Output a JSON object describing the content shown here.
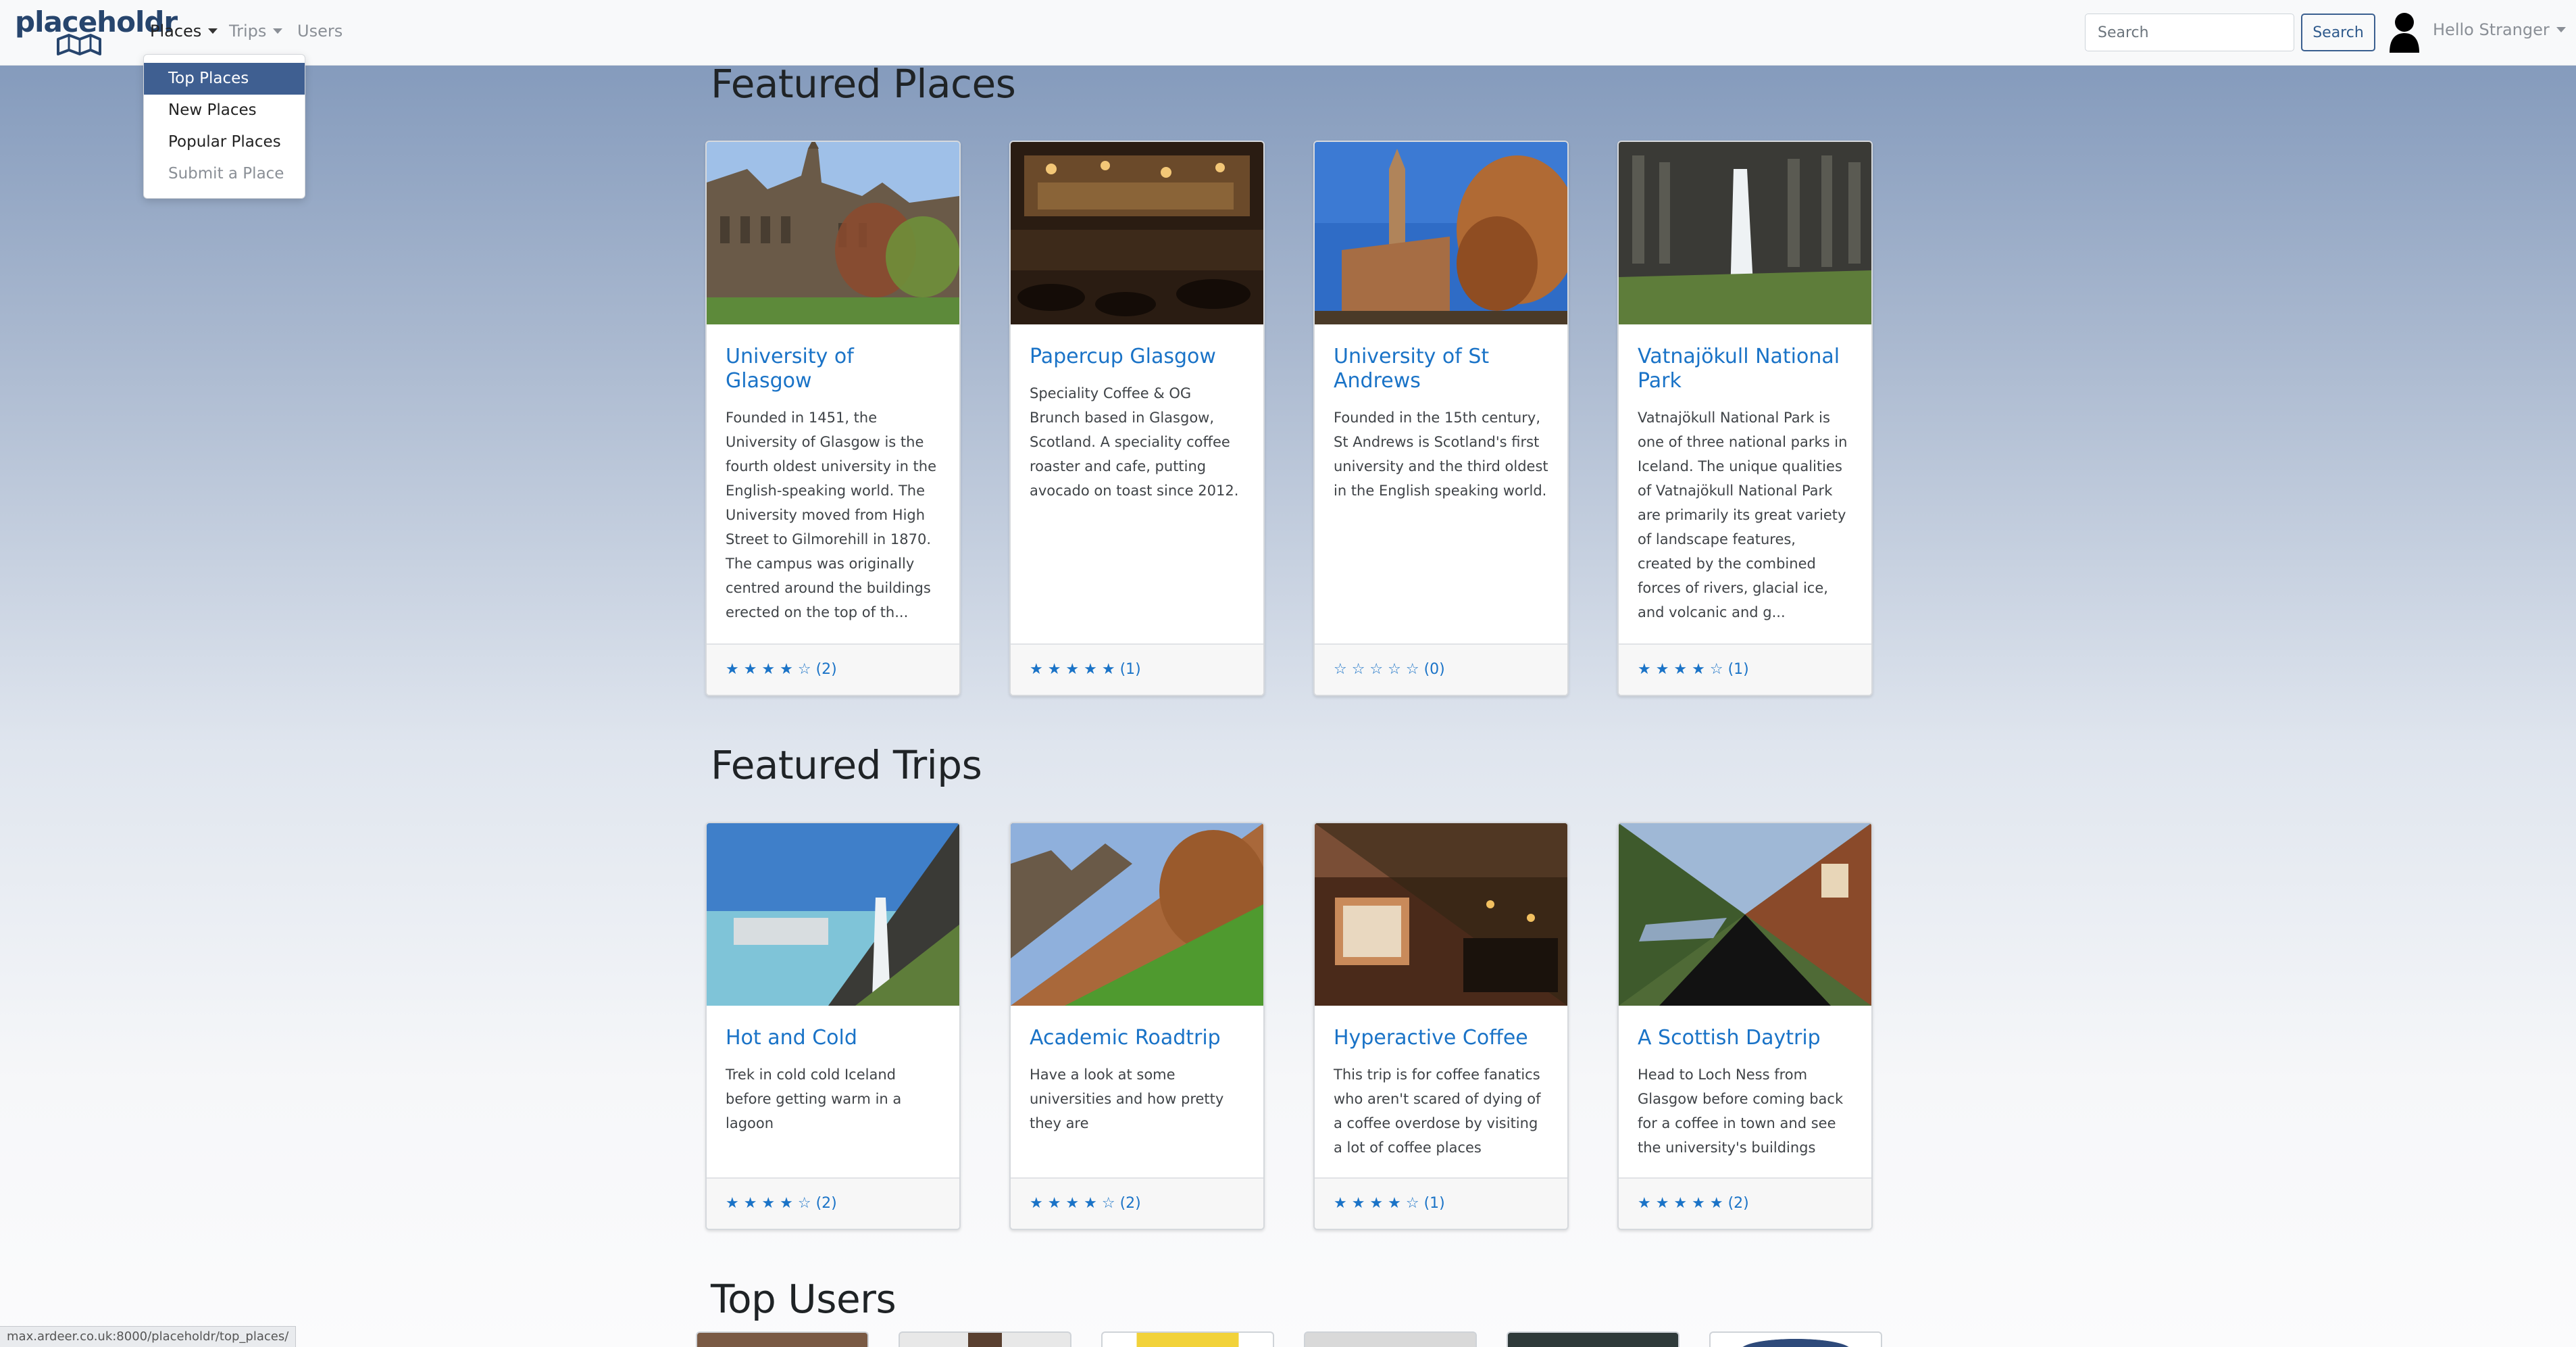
{
  "navbar": {
    "brand": "placeholdr",
    "menu": [
      {
        "label": "Places",
        "has_dropdown": true,
        "state": "open"
      },
      {
        "label": "Trips",
        "has_dropdown": true,
        "state": "muted"
      },
      {
        "label": "Users",
        "has_dropdown": false,
        "state": "muted"
      }
    ],
    "search_placeholder": "Search",
    "search_button": "Search",
    "user_greeting": "Hello Stranger",
    "user_icon": "user-silhouette-icon"
  },
  "places_dropdown": {
    "items": [
      {
        "label": "Top Places",
        "state": "active"
      },
      {
        "label": "New Places",
        "state": "normal"
      },
      {
        "label": "Popular Places",
        "state": "normal"
      },
      {
        "label": "Submit a Place",
        "state": "disabled"
      }
    ]
  },
  "featured_places": {
    "title": "Featured Places",
    "cards": [
      {
        "title": "University of Glasgow",
        "description": "Founded in 1451, the University of Glasgow is the fourth oldest university in the English-speaking world. The University moved from High Street to Gilmorehill in 1870. The campus was originally centred around the buildings erected on the top of th...",
        "rating_stars": "★ ★ ★ ★ ☆",
        "rating_count": "(2)",
        "rating": 4
      },
      {
        "title": "Papercup Glasgow",
        "description": "Speciality Coffee & OG Brunch based in Glasgow, Scotland. A speciality coffee roaster and cafe, putting avocado on toast since 2012.",
        "rating_stars": "★ ★ ★ ★ ★",
        "rating_count": "(1)",
        "rating": 5
      },
      {
        "title": "University of St Andrews",
        "description": "Founded in the 15th century, St Andrews is Scotland's first university and the third oldest in the English speaking world.",
        "rating_stars": "☆ ☆ ☆ ☆ ☆",
        "rating_count": "(0)",
        "rating": 0
      },
      {
        "title": "Vatnajökull National Park",
        "description": "Vatnajökull National Park is one of three national parks in Iceland. The unique qualities of Vatnajökull National Park are primarily its great variety of landscape features, created by the combined forces of rivers, glacial ice, and volcanic and g...",
        "rating_stars": "★ ★ ★ ★ ☆",
        "rating_count": "(1)",
        "rating": 4
      }
    ]
  },
  "featured_trips": {
    "title": "Featured Trips",
    "cards": [
      {
        "title": "Hot and Cold",
        "description": "Trek in cold cold Iceland before getting warm in a lagoon",
        "rating_stars": "★ ★ ★ ★ ☆",
        "rating_count": "(2)",
        "rating": 4
      },
      {
        "title": "Academic Roadtrip",
        "description": "Have a look at some universities and how pretty they are",
        "rating_stars": "★ ★ ★ ★ ☆",
        "rating_count": "(2)",
        "rating": 4
      },
      {
        "title": "Hyperactive Coffee",
        "description": "This trip is for coffee fanatics who aren't scared of dying of a coffee overdose by visiting a lot of coffee places",
        "rating_stars": "★ ★ ★ ★ ☆",
        "rating_count": "(1)",
        "rating": 4
      },
      {
        "title": "A Scottish Daytrip",
        "description": "Head to Loch Ness from Glasgow before coming back for a coffee in town and see the university's buildings",
        "rating_stars": "★ ★ ★ ★ ★",
        "rating_count": "(2)",
        "rating": 5
      }
    ]
  },
  "top_users": {
    "title": "Top Users"
  },
  "status_bar": {
    "url": "max.ardeer.co.uk:8000/placeholdr/top_places/"
  },
  "colors": {
    "link": "#1a73c7",
    "dropdown_active": "#3f5f91",
    "brand": "#27456d"
  }
}
